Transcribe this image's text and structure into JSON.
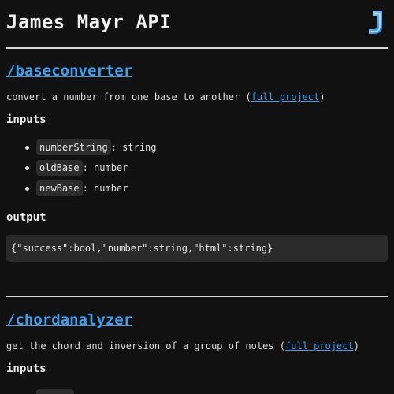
{
  "site": {
    "title": "James Mayr API",
    "logo_icon": "j-logo-icon"
  },
  "colors": {
    "background": "#111111",
    "link": "#3aa0f0",
    "code_bg": "#2a2a2a",
    "logo_blue": "#2fa8ff"
  },
  "sections": [
    {
      "endpoint": "/baseconverter",
      "description_prefix": "convert a number from one base to another (",
      "project_link": "full project",
      "description_suffix": ")",
      "inputs_heading": "inputs",
      "inputs": [
        {
          "name": "numberString",
          "type": ": string"
        },
        {
          "name": "oldBase",
          "type": ": number"
        },
        {
          "name": "newBase",
          "type": ": number"
        }
      ],
      "output_heading": "output",
      "output": "{\"success\":bool,\"number\":string,\"html\":string}"
    },
    {
      "endpoint": "/chordanalyzer",
      "description_prefix": "get the chord and inversion of a group of notes (",
      "project_link": "full project",
      "description_suffix": ")",
      "inputs_heading": "inputs"
    }
  ]
}
